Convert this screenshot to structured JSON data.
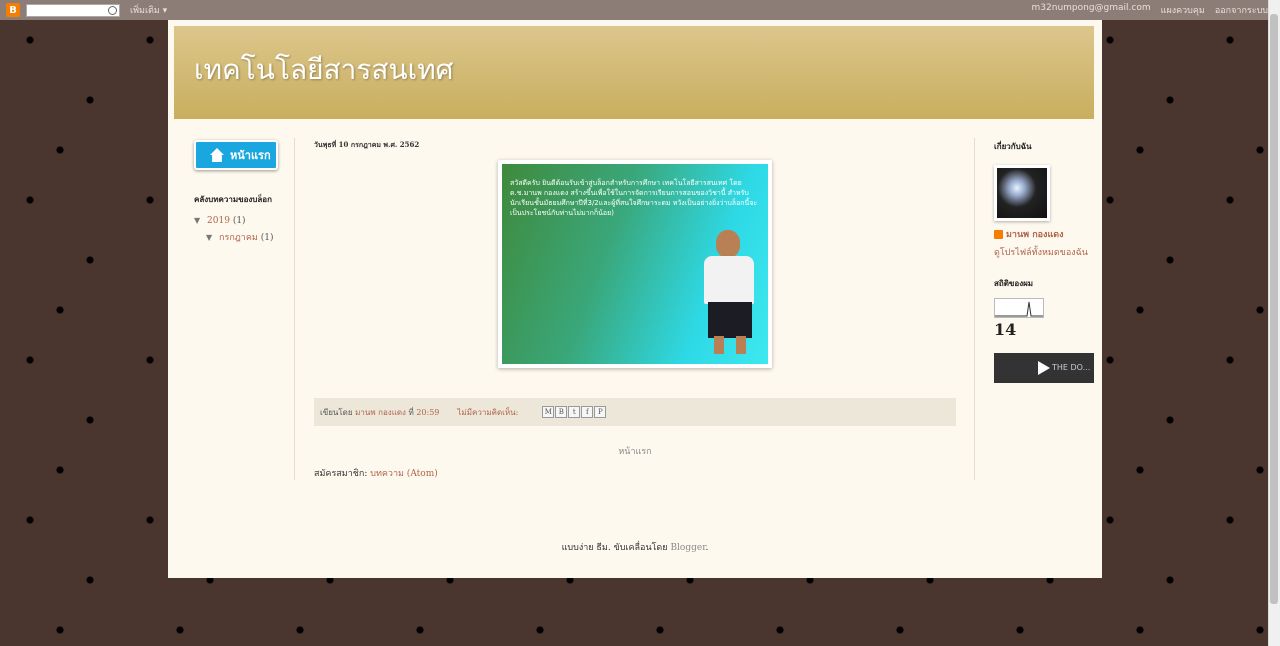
{
  "navbar": {
    "more_label": "เพิ่มเติม ▾",
    "email": "m32numpong@gmail.com",
    "dashboard_label": "แผงควบคุม",
    "signout_label": "ออกจากระบบ"
  },
  "header": {
    "title": "เทคโนโลยีสารสนเทศ"
  },
  "left": {
    "home_label": "หน้าแรก",
    "archive_title": "คลังบทความของบล็อก",
    "archive_year": "2019",
    "archive_year_count": "(1)",
    "archive_month": "กรกฎาคม",
    "archive_month_count": "(1)"
  },
  "post": {
    "date": "วันพุธที่ 10 กรกฎาคม พ.ศ. 2562",
    "caption": "สวัสดีครับ ยินดีต้อนรับเข้าสู่บล็อกสำหรับการศึกษา เทคโนโลยีสารสนเทศ โดย ด.ช.มานพ กองแดง สร้างขึ้นเพื่อใช้ในการจัดการเรียนการสอนของวิชานี้ สำหรับนักเรียนชั้นมัธยมศึกษาปีที่3/2และผู้ที่สนใจศึกษาระดม หวังเป็นอย่างยิ่งว่าบล็อกนี้จะเป็นประโยชน์กับท่านไม่มากก็น้อย)",
    "posted_by": "เขียนโดย",
    "author": "มานพ กองแดง",
    "at": "ที่",
    "time": "20:59",
    "comments": "ไม่มีความคิดเห็น:",
    "share": [
      "M",
      "B",
      "t",
      "f",
      "P"
    ]
  },
  "nav": {
    "home": "หน้าแรก"
  },
  "subscribe": {
    "label": "สมัครสมาชิก:",
    "link": "บทความ (Atom)"
  },
  "right": {
    "about_title": "เกี่ยวกับฉัน",
    "name": "มานพ กองแดง",
    "profile_link": "ดูโปรไฟล์ทั้งหมดของฉัน",
    "stats_title": "สถิติของผม",
    "count": "14",
    "video_title": "THE DO..."
  },
  "footer": {
    "text": "แบบง่าย ธีม. ขับเคลื่อนโดย",
    "link": "Blogger",
    "end": "."
  }
}
